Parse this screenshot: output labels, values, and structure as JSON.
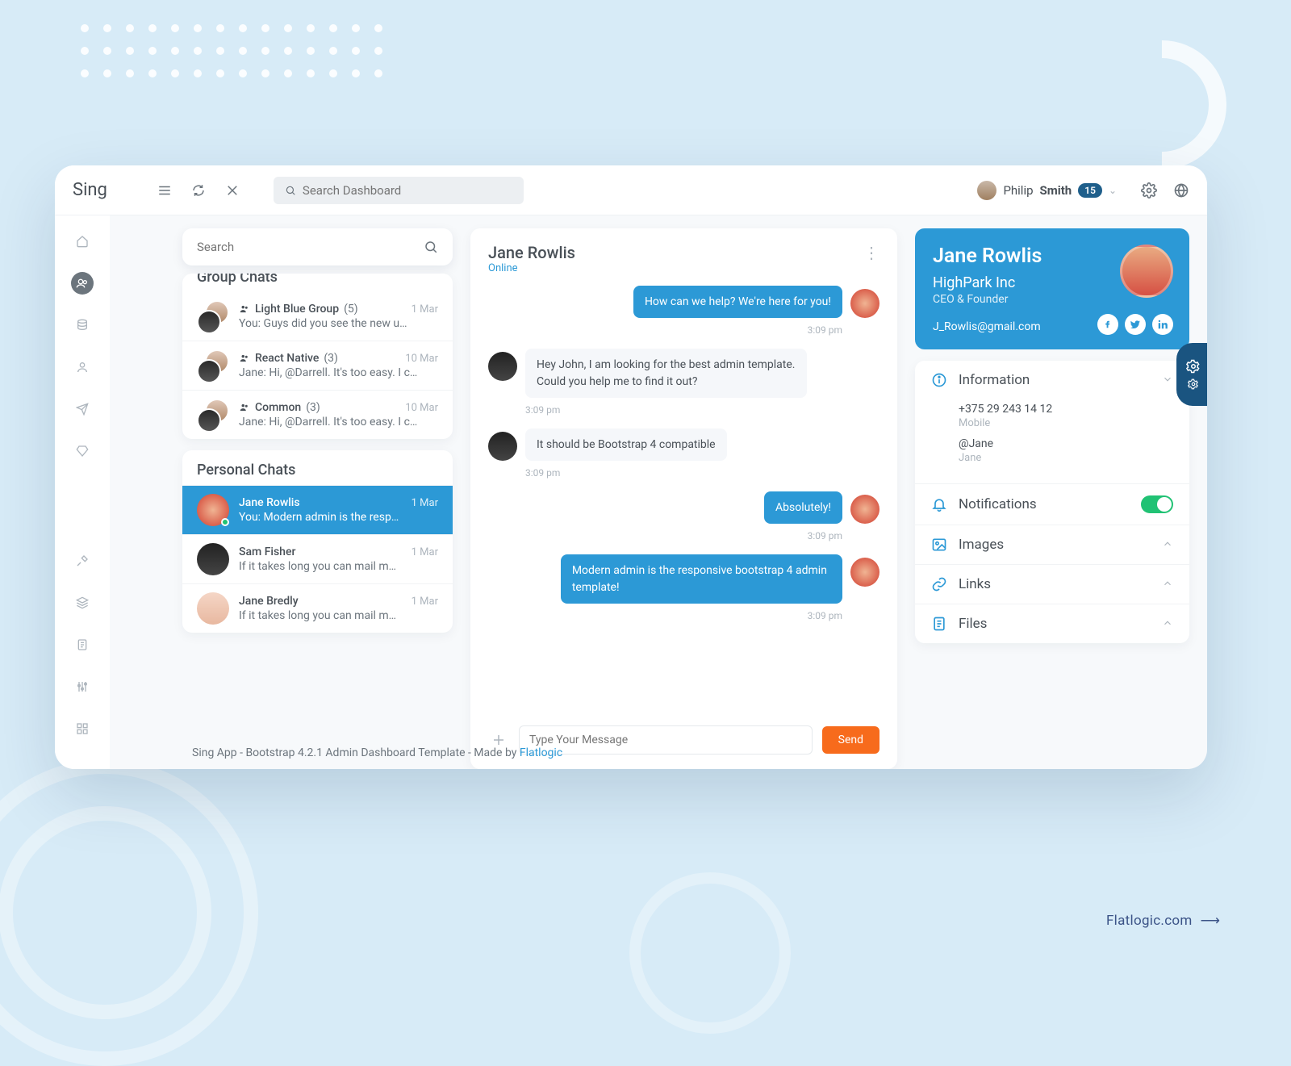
{
  "brand": "Sing",
  "search_top_placeholder": "Search Dashboard",
  "user": {
    "first": "Philip",
    "last": "Smith",
    "count": "15"
  },
  "sidebar_search_placeholder": "Search",
  "group_chats_title": "Group Chats",
  "group_chats": [
    {
      "name": "Light Blue Group",
      "count": "(5)",
      "date": "1 Mar",
      "preview": "You:  Guys did you see the new u…"
    },
    {
      "name": "React Native",
      "count": "(3)",
      "date": "10 Mar",
      "preview": "Jane:  Hi, @Darrell. It's too easy. I c…"
    },
    {
      "name": "Common",
      "count": "(3)",
      "date": "10 Mar",
      "preview": "Jane:  Hi, @Darrell. It's too easy. I c…"
    }
  ],
  "personal_chats_title": "Personal Chats",
  "personal_chats": [
    {
      "name": "Jane Rowlis",
      "date": "1 Mar",
      "preview": "You:  Modern admin is the resp…",
      "selected": true,
      "online": true
    },
    {
      "name": "Sam Fisher",
      "date": "1 Mar",
      "preview": "If it takes long you can mail m…"
    },
    {
      "name": "Jane Bredly",
      "date": "1 Mar",
      "preview": "If it takes long you can mail m…"
    }
  ],
  "chat": {
    "title": "Jane Rowlis",
    "status": "Online",
    "messages": [
      {
        "dir": "out",
        "text": "How can we help? We're here for you!",
        "time": "3:09 pm"
      },
      {
        "dir": "in",
        "text": "Hey John, I am looking for the best admin template. Could you help me to find it out?",
        "time": "3:09 pm"
      },
      {
        "dir": "in",
        "text": "It should be Bootstrap 4 compatible",
        "time": "3:09 pm"
      },
      {
        "dir": "out",
        "text": "Absolutely!",
        "time": "3:09 pm"
      },
      {
        "dir": "out",
        "text": "Modern admin is the responsive bootstrap 4 admin template!",
        "time": "3:09 pm"
      }
    ],
    "composer_placeholder": "Type Your Message",
    "send_label": "Send"
  },
  "profile": {
    "name": "Jane Rowlis",
    "company": "HighPark Inc",
    "role": "CEO & Founder",
    "email": "J_Rowlis@gmail.com"
  },
  "info": {
    "information_label": "Information",
    "phone": "+375 29 243 14 12",
    "phone_sub": "Mobile",
    "handle": "@Jane",
    "handle_sub": "Jane",
    "notifications_label": "Notifications",
    "images_label": "Images",
    "links_label": "Links",
    "files_label": "Files"
  },
  "footer": {
    "text": "Sing App - Bootstrap 4.2.1 Admin Dashboard Template - Made by ",
    "link": "Flatlogic"
  },
  "tag": "Flatlogic.com"
}
